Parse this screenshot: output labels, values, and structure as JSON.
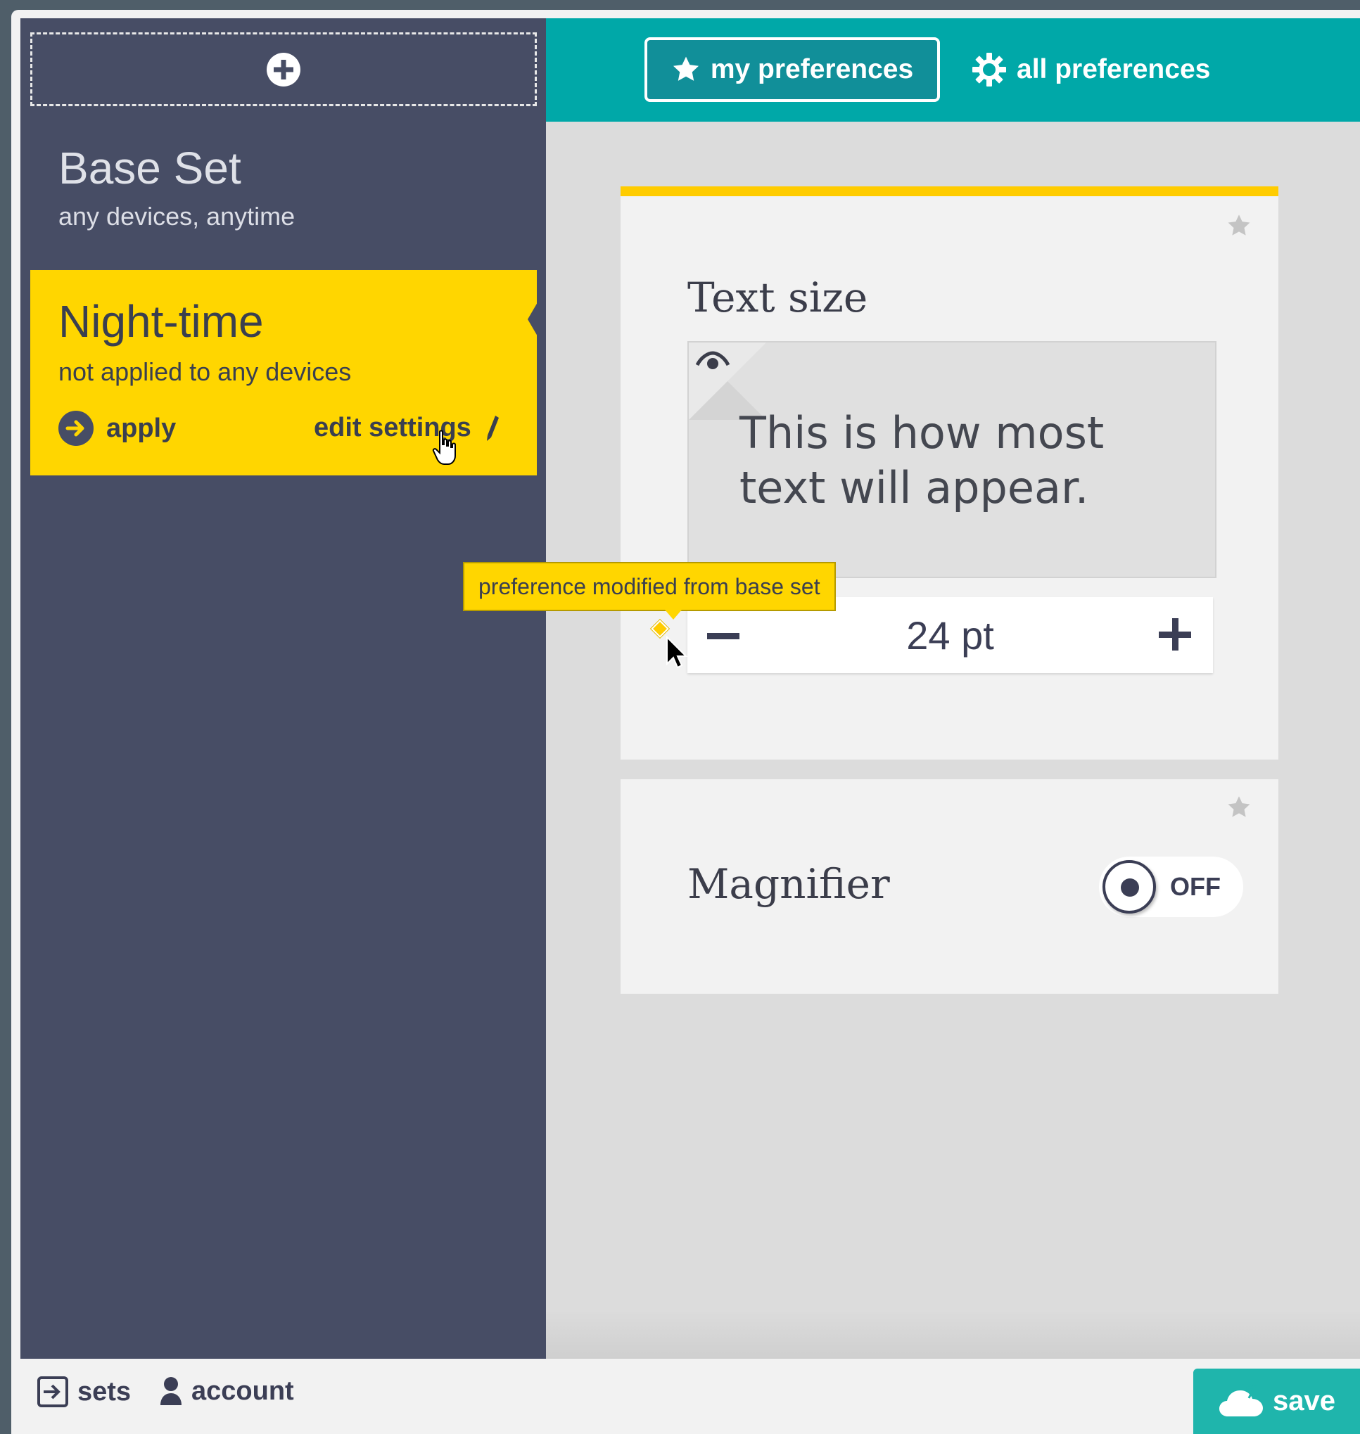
{
  "sidebar": {
    "add_set_icon": "plus-circle-icon",
    "base_set": {
      "title": "Base Set",
      "subtitle": "any devices, anytime"
    },
    "night_set": {
      "title": "Night-time",
      "subtitle": "not applied to any devices",
      "apply_label": "apply",
      "edit_label": "edit settings"
    }
  },
  "tabs": {
    "my_preferences": "my preferences",
    "all_preferences": "all preferences"
  },
  "cards": {
    "text_size": {
      "title": "Text size",
      "preview_text": "This is how most text will appear.",
      "value": "24 pt",
      "tooltip": "preference modified from base set"
    },
    "magnifier": {
      "title": "Magnifier",
      "toggle_label": "OFF"
    }
  },
  "footer": {
    "sets_label": "sets",
    "account_label": "account",
    "save_label": "save"
  },
  "colors": {
    "sidebar_bg": "#474d65",
    "accent_yellow": "#ffd600",
    "teal": "#00a8a8",
    "save_teal": "#1fb5ac"
  }
}
